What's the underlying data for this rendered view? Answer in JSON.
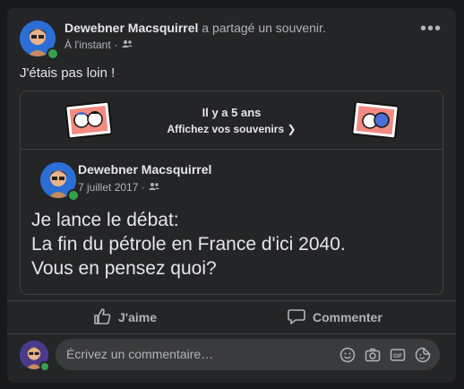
{
  "post": {
    "author": "Dewebner Macsquirrel",
    "action": "a partagé un souvenir.",
    "time": "À l'instant",
    "text": "J'étais pas loin !",
    "audience_icon": "friends-icon"
  },
  "memory": {
    "title": "Il y a 5 ans",
    "link": "Affichez vos souvenirs",
    "link_icon": "chevron-right-icon"
  },
  "shared_post": {
    "author": "Dewebner Macsquirrel",
    "date": "7 juillet 2017 ·",
    "lines": [
      "Je lance le débat:",
      "La fin du pétrole en France d'ici 2040.",
      "Vous en pensez quoi?"
    ]
  },
  "actions": {
    "like": "J'aime",
    "comment": "Commenter"
  },
  "comment_box": {
    "placeholder": "Écrivez un commentaire…"
  },
  "colors": {
    "card_bg": "#242526",
    "page_bg": "#18191a",
    "online": "#31a24c",
    "input_bg": "#3a3b3c"
  }
}
